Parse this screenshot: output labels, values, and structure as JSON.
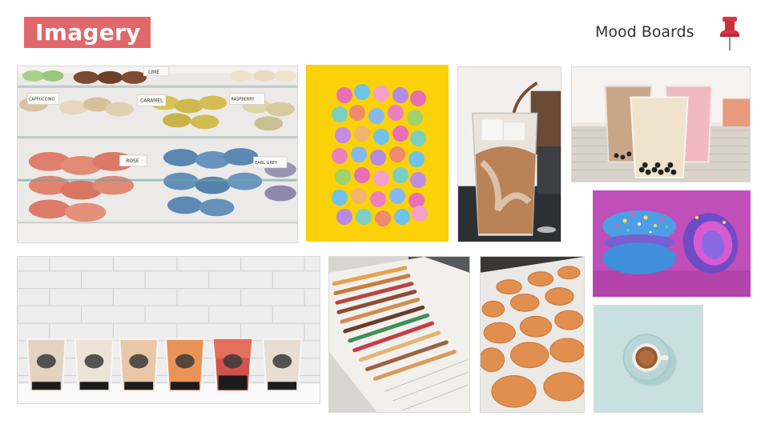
{
  "slide": {
    "title": "Imagery",
    "subtitle": "Mood Boards"
  },
  "icons": {
    "pin": "pushpin-icon"
  },
  "colors": {
    "accent": "#e0676a",
    "pin": "#d9343f"
  },
  "images": [
    {
      "name": "macaron-display-case-photo",
      "labels": [
        "LIME",
        "CAPPUCCINO",
        "CARAMEL",
        "RASPBERRY",
        "ROSE",
        "EARL GREY"
      ]
    },
    {
      "name": "rainbow-macarons-yellow-photo",
      "labels": []
    },
    {
      "name": "iced-coffee-pour-photo",
      "labels": []
    },
    {
      "name": "bubble-tea-cups-photo",
      "labels": []
    },
    {
      "name": "galaxy-macarons-purple-photo",
      "labels": []
    },
    {
      "name": "boba-cups-row-photo",
      "labels": []
    },
    {
      "name": "macaron-production-line-photo",
      "labels": []
    },
    {
      "name": "macaron-shells-tray-photo",
      "labels": []
    },
    {
      "name": "coffee-cup-topview-photo",
      "labels": []
    }
  ]
}
